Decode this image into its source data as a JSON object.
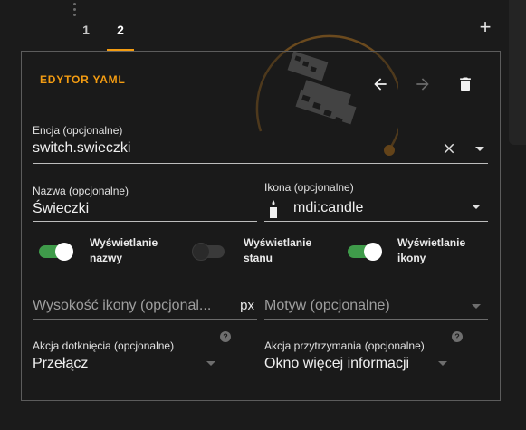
{
  "tabs": [
    {
      "label": "1"
    },
    {
      "label": "2"
    }
  ],
  "add_tab_icon": "plus-icon",
  "editor": {
    "yaml_label": "EDYTOR YAML",
    "move_left_icon": "arrow-left-icon",
    "move_right_icon": "arrow-right-icon",
    "delete_icon": "trash-icon"
  },
  "entity": {
    "label": "Encja (opcjonalne)",
    "value": "switch.swieczki"
  },
  "name": {
    "label": "Nazwa (opcjonalne)",
    "value": "Świeczki"
  },
  "icon_field": {
    "label": "Ikona (opcjonalne)",
    "value": "mdi:candle"
  },
  "toggles": [
    {
      "label_line1": "Wyświetlanie",
      "label_line2": "nazwy",
      "on": true
    },
    {
      "label_line1": "Wyświetlanie",
      "label_line2": "stanu",
      "on": false
    },
    {
      "label_line1": "Wyświetlanie",
      "label_line2": "ikony",
      "on": true
    }
  ],
  "icon_height": {
    "placeholder": "Wysokość ikony (opcjonal...",
    "suffix": "px"
  },
  "theme": {
    "placeholder": "Motyw (opcjonalne)"
  },
  "tap_action": {
    "label": "Akcja dotknięcia (opcjonalne)",
    "value": "Przełącz"
  },
  "hold_action": {
    "label": "Akcja przytrzymania (opcjonalne)",
    "value": "Okno więcej informacji"
  },
  "colors": {
    "accent": "#f39c12",
    "toggle_on": "#3f9b4a",
    "background": "#1b1b1b"
  }
}
